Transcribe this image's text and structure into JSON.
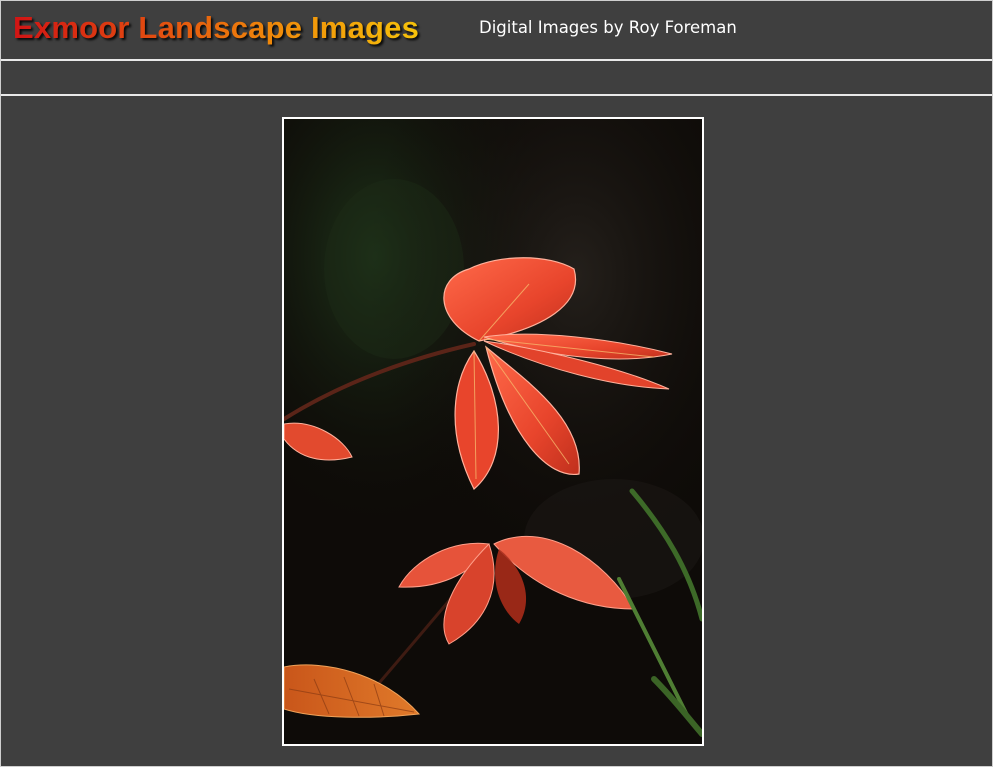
{
  "header": {
    "title": "Exmoor Landscape Images",
    "subtitle": "Digital Images by Roy Foreman"
  },
  "photo": {
    "subject": "red-leaf-sprig"
  },
  "colors": {
    "background": "#3f3f3f",
    "divider": "#e9e9e9",
    "title_gradient_start": "#d11414",
    "title_gradient_end": "#f6c20a",
    "subtitle": "#ffffff",
    "photo_border": "#ffffff"
  }
}
